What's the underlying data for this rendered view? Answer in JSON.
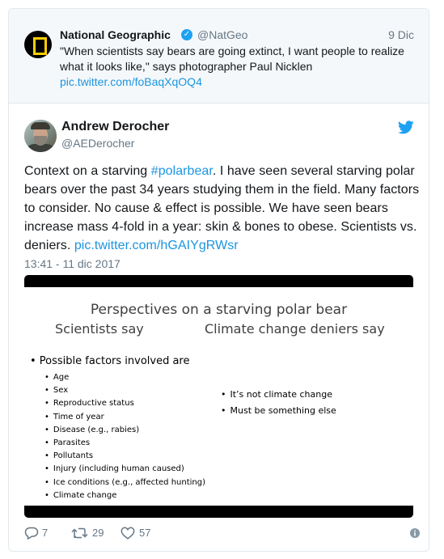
{
  "quoted_tweet": {
    "name": "National Geographic",
    "handle": "@NatGeo",
    "date": "9 Dic",
    "text": "\"When scientists say bears are going extinct, I want people to realize what it looks like,\" says photographer Paul Nicklen",
    "link": "pic.twitter.com/foBaqXqOQ4"
  },
  "tweet": {
    "name": "Andrew Derocher",
    "handle": "@AEDerocher",
    "text_before": "Context on a starving ",
    "hashtag": "#polarbear",
    "text_after": ". I have seen several starving polar bears over the past 34 years studying them in the field. Many factors to consider. No cause & effect is possible. We have seen bears increase mass 4-fold in a year: skin & bones to obese. Scientists vs. deniers. ",
    "link": "pic.twitter.com/hGAIYgRWsr",
    "timestamp": "13:41 - 11 dic 2017"
  },
  "slide": {
    "title": "Perspectives on a starving polar bear",
    "col_left_heading": "Scientists say",
    "col_right_heading": "Climate change deniers say",
    "lead": "• Possible factors involved are",
    "factors": [
      "Age",
      "Sex",
      "Reproductive status",
      "Time of year",
      "Disease (e.g., rabies)",
      "Parasites",
      "Pollutants",
      "Injury (including human caused)",
      "Ice conditions (e.g., affected hunting)",
      "Climate change"
    ],
    "denier_points": [
      "It’s not climate change",
      "Must be something else"
    ]
  },
  "actions": {
    "replies": "7",
    "retweets": "29",
    "likes": "57"
  },
  "colors": {
    "link": "#1b95e0",
    "secondary_text": "#657786",
    "twitter_blue": "#1da1f2",
    "border": "#e1e8ed"
  },
  "icons": {
    "verified": "verified-badge-icon",
    "twitter": "twitter-bird-icon",
    "reply": "reply-icon",
    "retweet": "retweet-icon",
    "like": "heart-icon",
    "info": "info-icon"
  }
}
